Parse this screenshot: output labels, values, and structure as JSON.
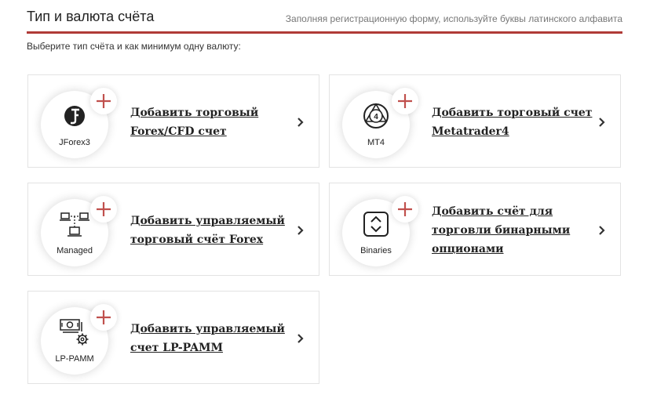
{
  "header": {
    "title": "Тип и валюта счёта",
    "hint": "Заполняя регистрационную форму, используйте буквы латинского алфавита"
  },
  "subtitle": "Выберите тип счёта и как минимум одну валюту:",
  "colors": {
    "accent": "#b03a37",
    "plus": "#c0504d",
    "card_border": "#e3e3e3"
  },
  "cards": [
    {
      "icon": "jforex-logo-icon",
      "caption": "JForex3",
      "label": "Добавить торговый Forex/CFD счет"
    },
    {
      "icon": "metatrader4-logo-icon",
      "caption": "MT4",
      "label": "Добавить торговый счет Metatrader4"
    },
    {
      "icon": "managed-network-icon",
      "caption": "Managed",
      "label": "Добавить управляемый торговый счёт Forex"
    },
    {
      "icon": "binaries-up-down-icon",
      "caption": "Binaries",
      "label": "Добавить счёт для торговли бинарными опционами"
    },
    {
      "icon": "lp-pamm-money-gear-icon",
      "caption": "LP-PAMM",
      "label": "Добавить управляемый счет LP-PAMM"
    }
  ]
}
